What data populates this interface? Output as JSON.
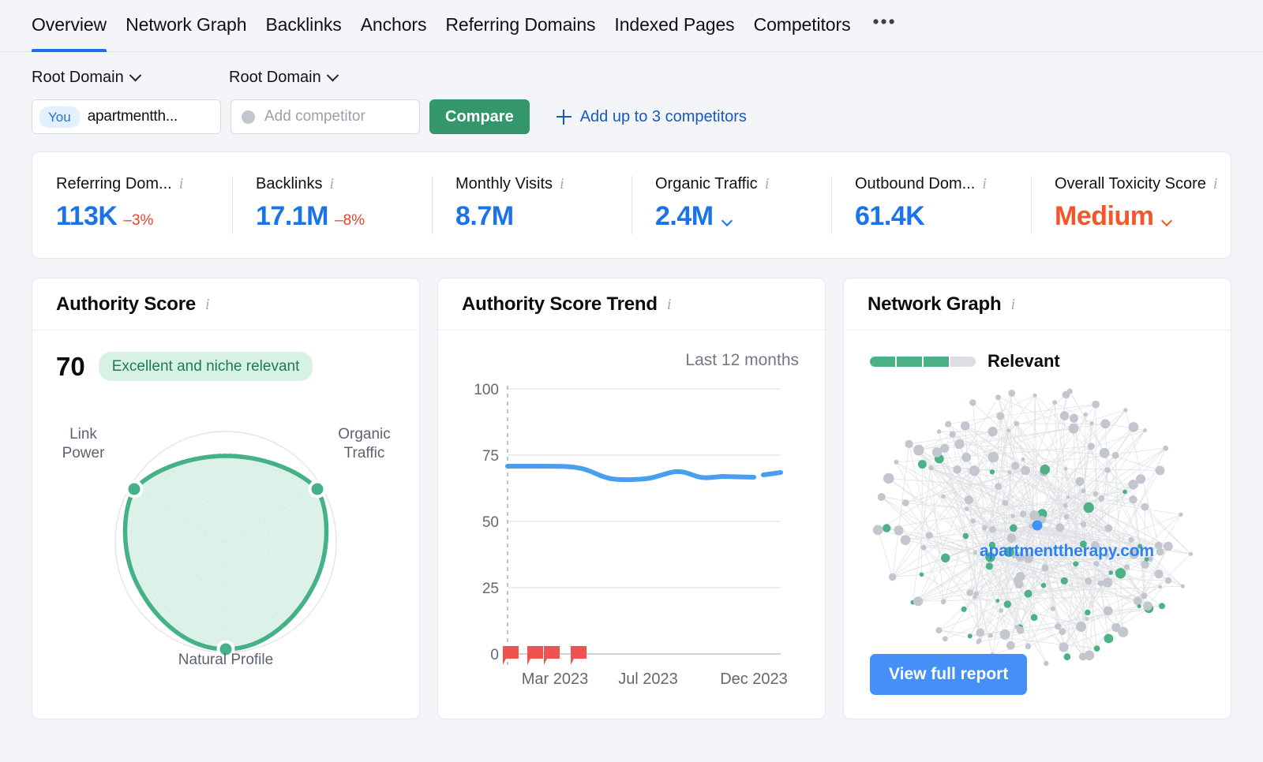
{
  "tabs": [
    {
      "label": "Overview",
      "active": true
    },
    {
      "label": "Network Graph",
      "active": false
    },
    {
      "label": "Backlinks",
      "active": false
    },
    {
      "label": "Anchors",
      "active": false
    },
    {
      "label": "Referring Domains",
      "active": false
    },
    {
      "label": "Indexed Pages",
      "active": false
    },
    {
      "label": "Competitors",
      "active": false
    }
  ],
  "tabs_more_label": "•••",
  "filters": {
    "scope_left": "Root Domain",
    "scope_right": "Root Domain",
    "you_badge": "You",
    "your_domain": "apartmentth...",
    "competitor_placeholder": "Add competitor",
    "compare_label": "Compare",
    "add_competitors_label": "Add up to 3 competitors"
  },
  "metrics": [
    {
      "label": "Referring Dom...",
      "value": "113K",
      "delta": "–3%",
      "has_dropdown": false,
      "color": "#1a73e8"
    },
    {
      "label": "Backlinks",
      "value": "17.1M",
      "delta": "–8%",
      "has_dropdown": false,
      "color": "#1a73e8"
    },
    {
      "label": "Monthly Visits",
      "value": "8.7M",
      "delta": "",
      "has_dropdown": false,
      "color": "#1a73e8"
    },
    {
      "label": "Organic Traffic",
      "value": "2.4M",
      "delta": "",
      "has_dropdown": true,
      "color": "#1a73e8"
    },
    {
      "label": "Outbound Dom...",
      "value": "61.4K",
      "delta": "",
      "has_dropdown": false,
      "color": "#1a73e8"
    },
    {
      "label": "Overall Toxicity Score",
      "value": "Medium",
      "delta": "",
      "has_dropdown": true,
      "color": "#f4562a"
    }
  ],
  "authority_card": {
    "title": "Authority Score",
    "score": "70",
    "badge": "Excellent and niche relevant",
    "axes": [
      "Organic Traffic",
      "Natural Profile",
      "Link Power"
    ]
  },
  "trend_card": {
    "title": "Authority Score Trend",
    "period": "Last 12 months"
  },
  "network_card": {
    "title": "Network Graph",
    "legend": "Relevant",
    "legend_filled_segments": 3,
    "legend_total_segments": 4,
    "center_domain": "apartmenttherapy.com",
    "button": "View full report"
  },
  "chart_data": [
    {
      "type": "radar",
      "title": "Authority Score",
      "categories": [
        "Organic Traffic",
        "Natural Profile",
        "Link Power"
      ],
      "values": [
        96,
        97,
        96
      ],
      "rlim": [
        0,
        100
      ],
      "rings": [
        20,
        40,
        60,
        80,
        100
      ],
      "grid": true,
      "legend": "none"
    },
    {
      "type": "line",
      "title": "Authority Score Trend",
      "subtitle": "Last 12 months",
      "xlabel": "",
      "ylabel": "",
      "ylim": [
        0,
        100
      ],
      "yticks": [
        0,
        25,
        50,
        75,
        100
      ],
      "xticks": [
        "Mar 2023",
        "Jul 2023",
        "Dec 2023"
      ],
      "grid": true,
      "x": [
        "Jan 2023",
        "Feb 2023",
        "Mar 2023",
        "Apr 2023",
        "May 2023",
        "Jun 2023",
        "Jul 2023",
        "Aug 2023",
        "Sep 2023",
        "Oct 2023",
        "Nov 2023",
        "Dec 2023"
      ],
      "series": [
        {
          "name": "Authority Score",
          "color": "#4a9ef0",
          "values": [
            71,
            71,
            71,
            71,
            70,
            69,
            69,
            69,
            70,
            71,
            70,
            70
          ]
        }
      ],
      "annotations": {
        "name": "Google algorithm update markers",
        "color": "#ef5350",
        "positions": [
          0.0,
          0.235,
          0.375,
          0.645
        ]
      }
    },
    {
      "type": "network",
      "title": "Network Graph",
      "center_node": "apartmenttherapy.com",
      "relevance": "Relevant",
      "relevance_level": 3,
      "relevance_max": 4,
      "node_colors": {
        "relevant": "#4cb286",
        "neutral": "#c3c6ce",
        "center": "#3c94f5"
      }
    }
  ]
}
